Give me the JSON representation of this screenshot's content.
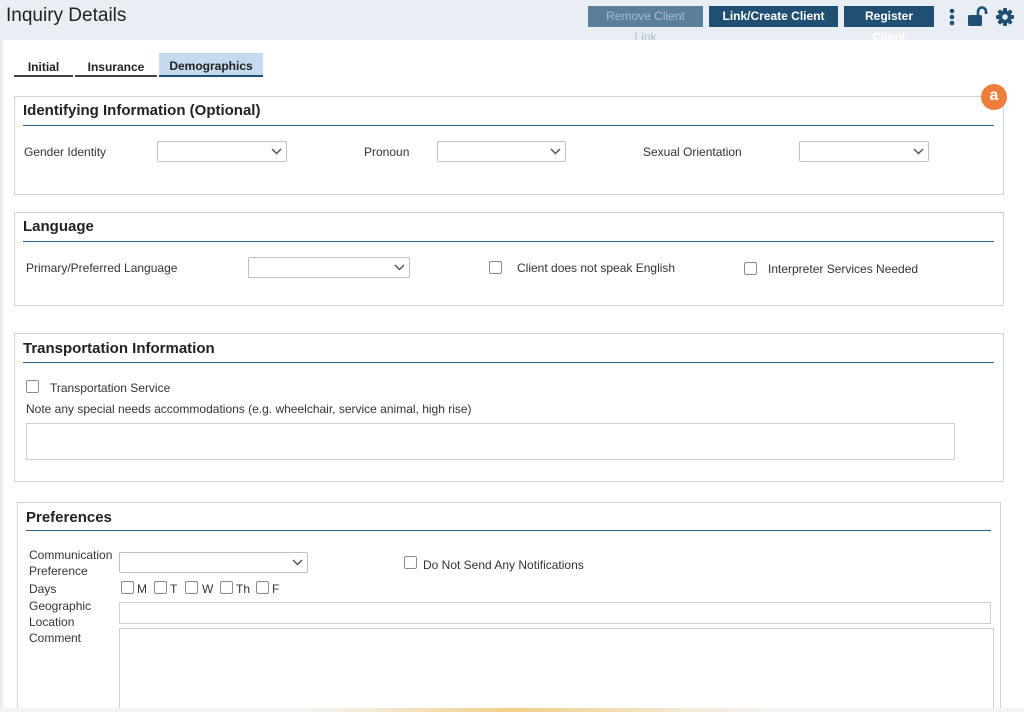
{
  "header": {
    "title": "Inquiry Details",
    "remove_link_label": "Remove Client Link",
    "link_create_label": "Link/Create Client",
    "register_label": "Register Client",
    "icons": [
      "more-vertical-icon",
      "unlock-icon",
      "gear-icon"
    ]
  },
  "tabs": [
    {
      "label": "Initial",
      "active": false
    },
    {
      "label": "Insurance",
      "active": false
    },
    {
      "label": "Demographics",
      "active": true
    }
  ],
  "badge": "a",
  "identifying": {
    "title": "Identifying Information (Optional)",
    "gender_label": "Gender Identity",
    "gender_value": "",
    "pronoun_label": "Pronoun",
    "pronoun_value": "",
    "orientation_label": "Sexual Orientation",
    "orientation_value": ""
  },
  "language": {
    "title": "Language",
    "primary_label": "Primary/Preferred Language",
    "primary_value": "",
    "no_english_label": "Client does not speak English",
    "interpreter_label": "Interpreter Services Needed"
  },
  "transportation": {
    "title": "Transportation Information",
    "service_label": "Transportation Service",
    "note_label": "Note any special needs accommodations (e.g. wheelchair, service animal, high rise)",
    "note_value": ""
  },
  "preferences": {
    "title": "Preferences",
    "comm_label_line1": "Communication",
    "comm_label_line2": "Preference",
    "comm_value": "",
    "no_notify_label": "Do Not Send Any Notifications",
    "days_label": "Days",
    "days": [
      "M",
      "T",
      "W",
      "Th",
      "F"
    ],
    "geo_label_line1": "Geographic",
    "geo_label_line2": "Location",
    "geo_value": "",
    "comment_label": "Comment",
    "comment_value": ""
  },
  "colors": {
    "accent": "#1f4f73",
    "active_tab": "#c4dbef",
    "badge": "#ef7d3c",
    "rule": "#2b5d86"
  }
}
